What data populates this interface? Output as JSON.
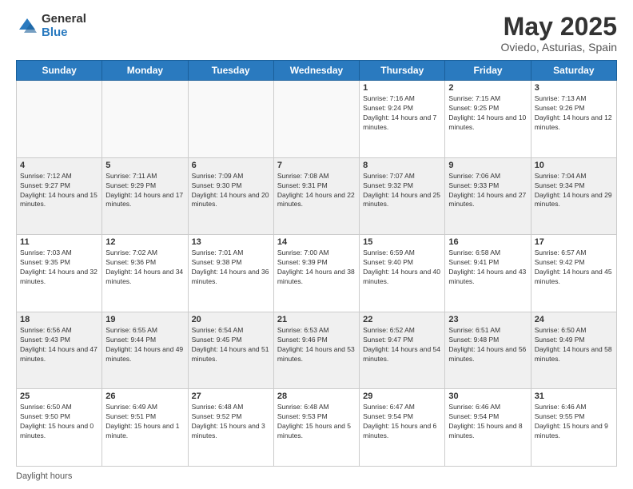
{
  "logo": {
    "general": "General",
    "blue": "Blue"
  },
  "header": {
    "month_year": "May 2025",
    "location": "Oviedo, Asturias, Spain"
  },
  "days_of_week": [
    "Sunday",
    "Monday",
    "Tuesday",
    "Wednesday",
    "Thursday",
    "Friday",
    "Saturday"
  ],
  "footer": {
    "daylight_label": "Daylight hours"
  },
  "weeks": [
    [
      {
        "day": "",
        "text": ""
      },
      {
        "day": "",
        "text": ""
      },
      {
        "day": "",
        "text": ""
      },
      {
        "day": "",
        "text": ""
      },
      {
        "day": "1",
        "text": "Sunrise: 7:16 AM\nSunset: 9:24 PM\nDaylight: 14 hours and 7 minutes."
      },
      {
        "day": "2",
        "text": "Sunrise: 7:15 AM\nSunset: 9:25 PM\nDaylight: 14 hours and 10 minutes."
      },
      {
        "day": "3",
        "text": "Sunrise: 7:13 AM\nSunset: 9:26 PM\nDaylight: 14 hours and 12 minutes."
      }
    ],
    [
      {
        "day": "4",
        "text": "Sunrise: 7:12 AM\nSunset: 9:27 PM\nDaylight: 14 hours and 15 minutes."
      },
      {
        "day": "5",
        "text": "Sunrise: 7:11 AM\nSunset: 9:29 PM\nDaylight: 14 hours and 17 minutes."
      },
      {
        "day": "6",
        "text": "Sunrise: 7:09 AM\nSunset: 9:30 PM\nDaylight: 14 hours and 20 minutes."
      },
      {
        "day": "7",
        "text": "Sunrise: 7:08 AM\nSunset: 9:31 PM\nDaylight: 14 hours and 22 minutes."
      },
      {
        "day": "8",
        "text": "Sunrise: 7:07 AM\nSunset: 9:32 PM\nDaylight: 14 hours and 25 minutes."
      },
      {
        "day": "9",
        "text": "Sunrise: 7:06 AM\nSunset: 9:33 PM\nDaylight: 14 hours and 27 minutes."
      },
      {
        "day": "10",
        "text": "Sunrise: 7:04 AM\nSunset: 9:34 PM\nDaylight: 14 hours and 29 minutes."
      }
    ],
    [
      {
        "day": "11",
        "text": "Sunrise: 7:03 AM\nSunset: 9:35 PM\nDaylight: 14 hours and 32 minutes."
      },
      {
        "day": "12",
        "text": "Sunrise: 7:02 AM\nSunset: 9:36 PM\nDaylight: 14 hours and 34 minutes."
      },
      {
        "day": "13",
        "text": "Sunrise: 7:01 AM\nSunset: 9:38 PM\nDaylight: 14 hours and 36 minutes."
      },
      {
        "day": "14",
        "text": "Sunrise: 7:00 AM\nSunset: 9:39 PM\nDaylight: 14 hours and 38 minutes."
      },
      {
        "day": "15",
        "text": "Sunrise: 6:59 AM\nSunset: 9:40 PM\nDaylight: 14 hours and 40 minutes."
      },
      {
        "day": "16",
        "text": "Sunrise: 6:58 AM\nSunset: 9:41 PM\nDaylight: 14 hours and 43 minutes."
      },
      {
        "day": "17",
        "text": "Sunrise: 6:57 AM\nSunset: 9:42 PM\nDaylight: 14 hours and 45 minutes."
      }
    ],
    [
      {
        "day": "18",
        "text": "Sunrise: 6:56 AM\nSunset: 9:43 PM\nDaylight: 14 hours and 47 minutes."
      },
      {
        "day": "19",
        "text": "Sunrise: 6:55 AM\nSunset: 9:44 PM\nDaylight: 14 hours and 49 minutes."
      },
      {
        "day": "20",
        "text": "Sunrise: 6:54 AM\nSunset: 9:45 PM\nDaylight: 14 hours and 51 minutes."
      },
      {
        "day": "21",
        "text": "Sunrise: 6:53 AM\nSunset: 9:46 PM\nDaylight: 14 hours and 53 minutes."
      },
      {
        "day": "22",
        "text": "Sunrise: 6:52 AM\nSunset: 9:47 PM\nDaylight: 14 hours and 54 minutes."
      },
      {
        "day": "23",
        "text": "Sunrise: 6:51 AM\nSunset: 9:48 PM\nDaylight: 14 hours and 56 minutes."
      },
      {
        "day": "24",
        "text": "Sunrise: 6:50 AM\nSunset: 9:49 PM\nDaylight: 14 hours and 58 minutes."
      }
    ],
    [
      {
        "day": "25",
        "text": "Sunrise: 6:50 AM\nSunset: 9:50 PM\nDaylight: 15 hours and 0 minutes."
      },
      {
        "day": "26",
        "text": "Sunrise: 6:49 AM\nSunset: 9:51 PM\nDaylight: 15 hours and 1 minute."
      },
      {
        "day": "27",
        "text": "Sunrise: 6:48 AM\nSunset: 9:52 PM\nDaylight: 15 hours and 3 minutes."
      },
      {
        "day": "28",
        "text": "Sunrise: 6:48 AM\nSunset: 9:53 PM\nDaylight: 15 hours and 5 minutes."
      },
      {
        "day": "29",
        "text": "Sunrise: 6:47 AM\nSunset: 9:54 PM\nDaylight: 15 hours and 6 minutes."
      },
      {
        "day": "30",
        "text": "Sunrise: 6:46 AM\nSunset: 9:54 PM\nDaylight: 15 hours and 8 minutes."
      },
      {
        "day": "31",
        "text": "Sunrise: 6:46 AM\nSunset: 9:55 PM\nDaylight: 15 hours and 9 minutes."
      }
    ]
  ]
}
